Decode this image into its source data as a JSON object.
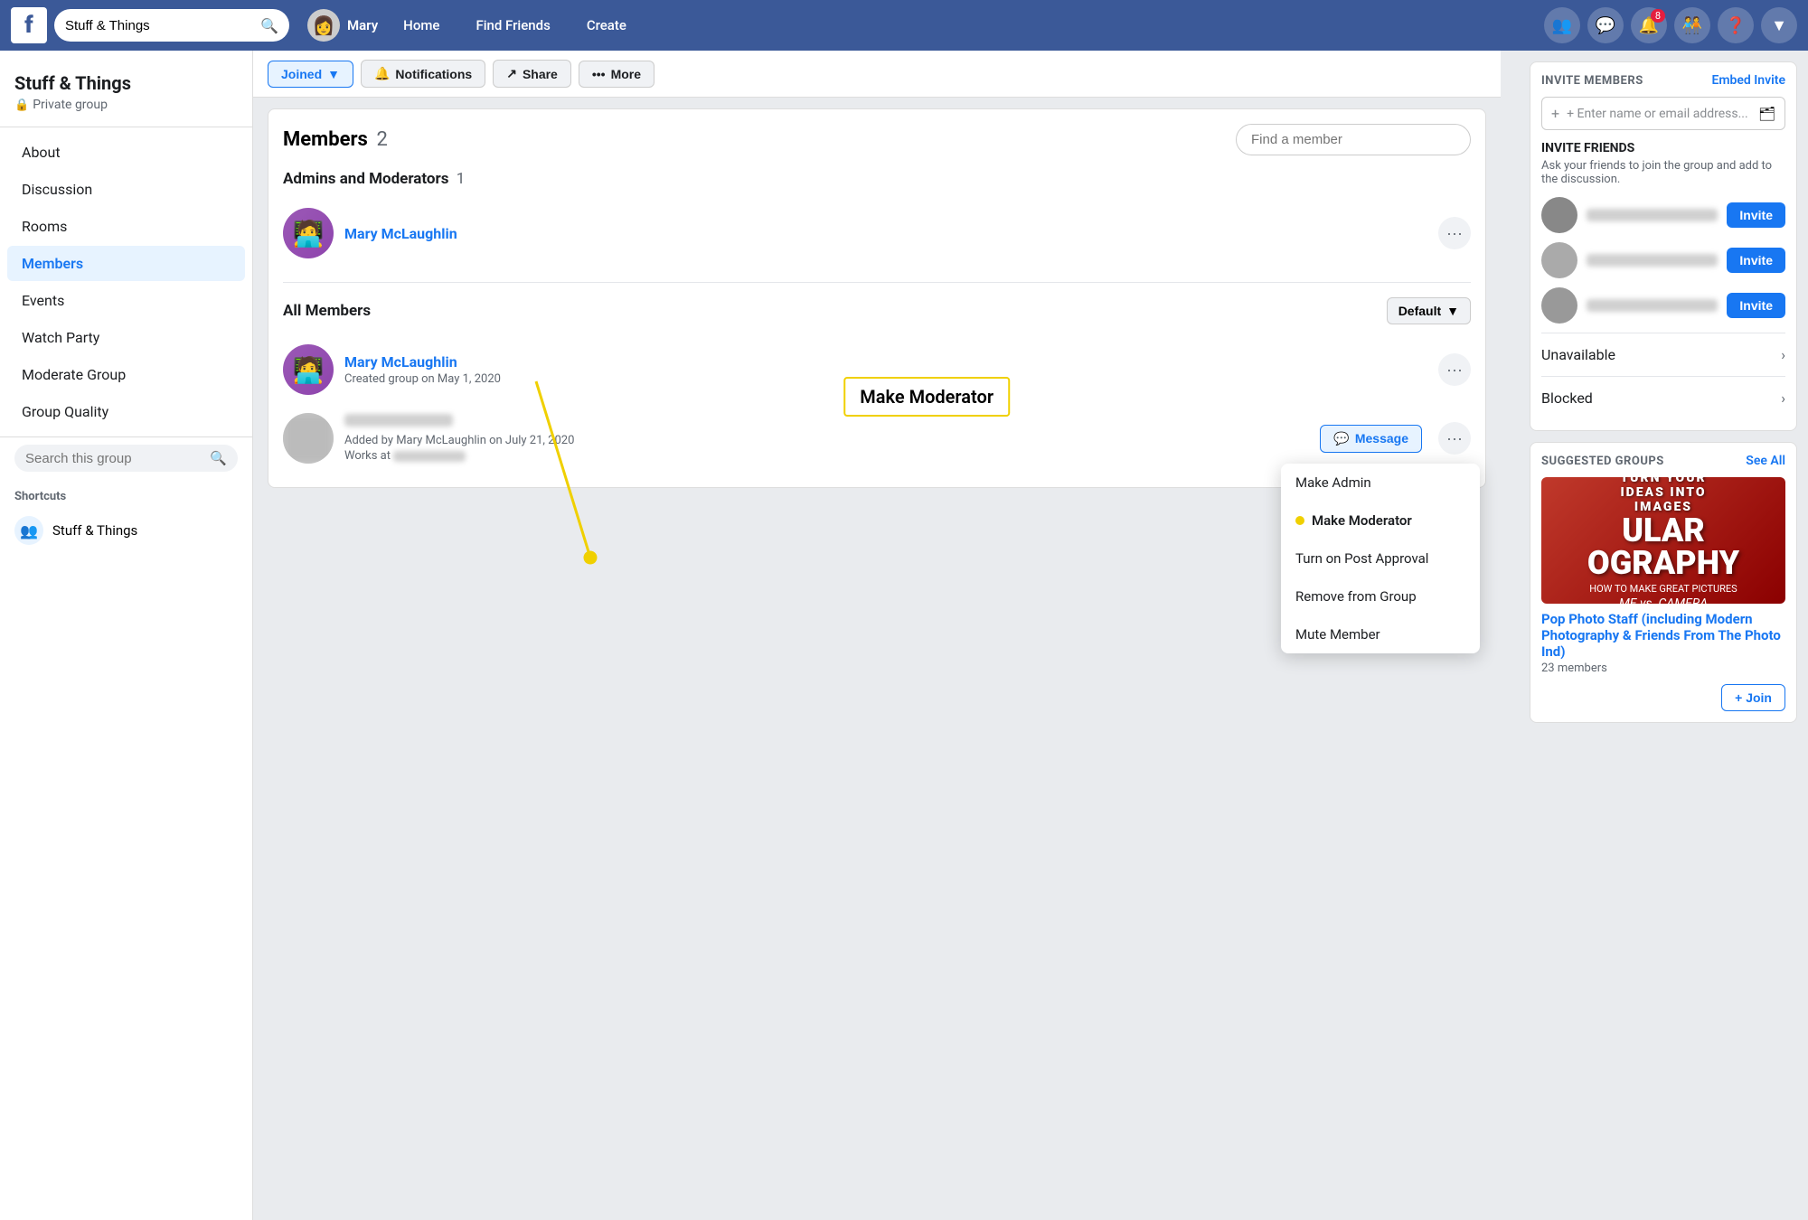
{
  "app": {
    "name": "Facebook"
  },
  "topnav": {
    "search_placeholder": "Stuff & Things",
    "user_name": "Mary",
    "links": [
      "Home",
      "Find Friends",
      "Create"
    ]
  },
  "sidebar": {
    "group_title": "Stuff & Things",
    "private_label": "Private group",
    "nav_items": [
      {
        "label": "About",
        "active": false
      },
      {
        "label": "Discussion",
        "active": false
      },
      {
        "label": "Rooms",
        "active": false
      },
      {
        "label": "Members",
        "active": true
      },
      {
        "label": "Events",
        "active": false
      },
      {
        "label": "Watch Party",
        "active": false
      },
      {
        "label": "Moderate Group",
        "active": false
      },
      {
        "label": "Group Quality",
        "active": false
      }
    ],
    "search_placeholder": "Search this group",
    "shortcuts_label": "Shortcuts",
    "shortcut_group": "Stuff & Things"
  },
  "action_bar": {
    "joined_label": "Joined",
    "notifications_label": "Notifications",
    "share_label": "Share",
    "more_label": "More"
  },
  "members": {
    "title": "Members",
    "count": "2",
    "find_placeholder": "Find a member",
    "admins_label": "Admins and Moderators",
    "admins_count": "1",
    "all_members_label": "All Members",
    "admin_member": {
      "name": "Mary McLaughlin",
      "sub": ""
    },
    "all_member1": {
      "name": "Mary McLaughlin",
      "sub": "Created group on May 1, 2020"
    },
    "all_member2": {
      "added_by": "Added by Mary McLaughlin on July 21, 2020",
      "works_at": "Works at"
    },
    "default_label": "Default"
  },
  "tooltip": {
    "label": "Make Moderator"
  },
  "context_menu": {
    "items": [
      {
        "label": "Make Admin",
        "highlighted": false
      },
      {
        "label": "Make Moderator",
        "highlighted": true
      },
      {
        "label": "Turn on Post Approval",
        "highlighted": false
      },
      {
        "label": "Remove from Group",
        "highlighted": false
      },
      {
        "label": "Mute Member",
        "highlighted": false
      }
    ]
  },
  "right_sidebar": {
    "invite_members_title": "INVITE MEMBERS",
    "embed_invite_label": "Embed Invite",
    "invite_input_placeholder": "+ Enter name or email address...",
    "invite_friends_title": "INVITE FRIENDS",
    "invite_friends_desc": "Ask your friends to join the group and add to the discussion.",
    "invite_btn_label": "Invite",
    "unavailable_label": "Unavailable",
    "blocked_label": "Blocked",
    "suggested_groups_title": "SUGGESTED GROUPS",
    "see_all_label": "See All",
    "suggested_group": {
      "name": "Pop Photo Staff (including Modern Photography & Friends From The Photo Ind)",
      "members_count": "23 members",
      "join_label": "+ Join",
      "image_text": "ULAR\nTOGRAPHY"
    }
  }
}
